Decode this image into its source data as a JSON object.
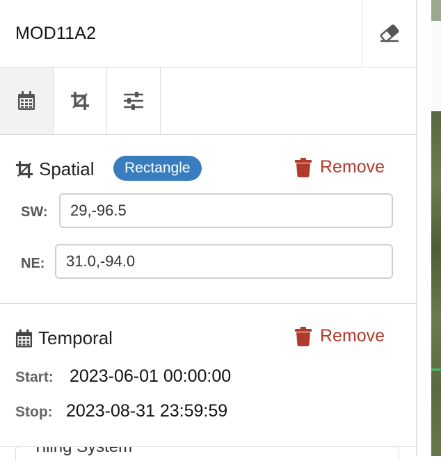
{
  "header": {
    "title": "MOD11A2",
    "clear_icon": "eraser-icon"
  },
  "tabs": [
    {
      "name": "temporal",
      "icon": "calendar-icon",
      "active": true
    },
    {
      "name": "spatial",
      "icon": "crop-icon",
      "active": false
    },
    {
      "name": "filters",
      "icon": "sliders-icon",
      "active": false
    }
  ],
  "spatial": {
    "title": "Spatial",
    "shape_badge": "Rectangle",
    "remove_label": "Remove",
    "sw": {
      "label": "SW:",
      "value": "29,-96.5"
    },
    "ne": {
      "label": "NE:",
      "value": "31.0,-94.0"
    }
  },
  "temporal": {
    "title": "Temporal",
    "remove_label": "Remove",
    "start": {
      "label": "Start:",
      "value": "2023-06-01 00:00:00"
    },
    "stop": {
      "label": "Stop:",
      "value": "2023-08-31 23:59:59"
    }
  },
  "next_section_label": "Tiling System",
  "colors": {
    "badge": "#3a7dbf",
    "remove": "#b13a2a",
    "active_tab": "#f2f2f2"
  }
}
